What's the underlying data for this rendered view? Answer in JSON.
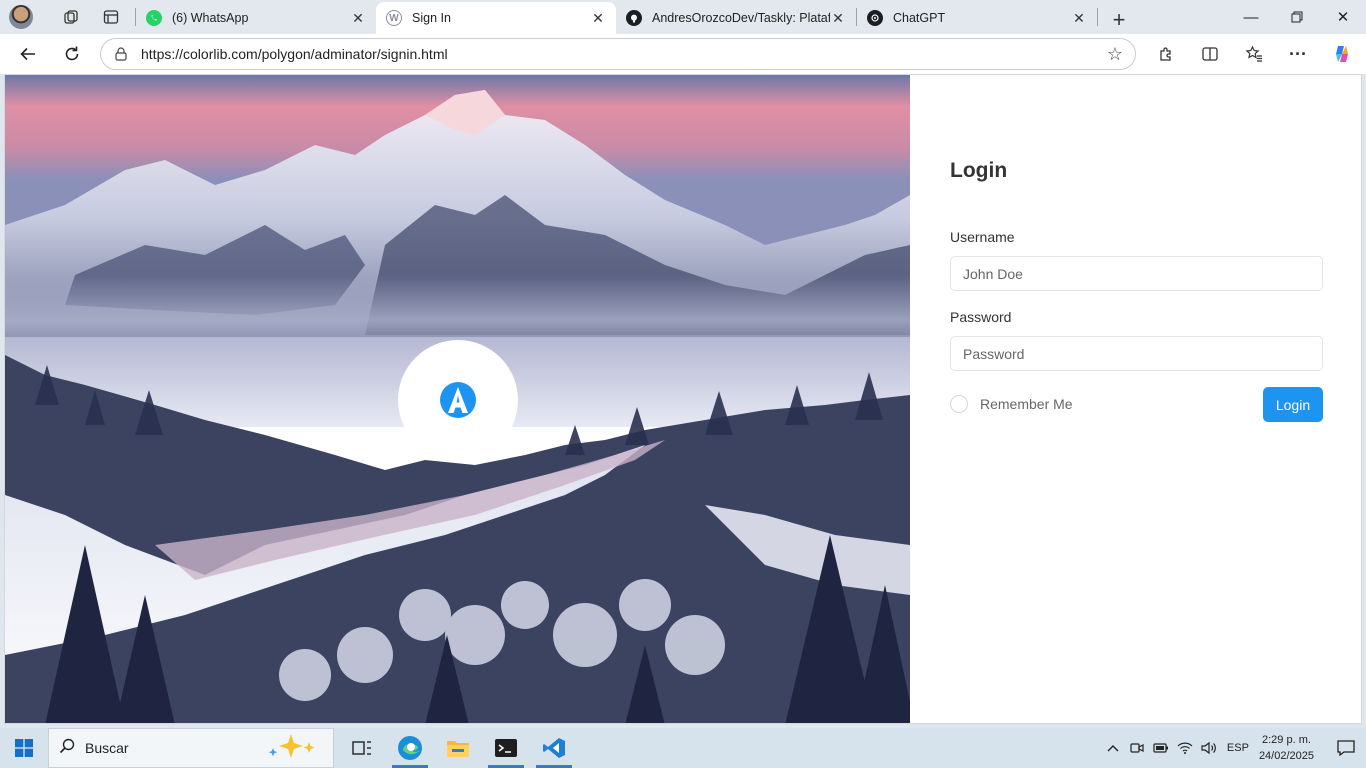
{
  "browser": {
    "tabs": [
      {
        "title": "(6) WhatsApp",
        "favicon": "whatsapp-icon",
        "color": "#25d366",
        "active": false
      },
      {
        "title": "Sign In",
        "favicon": "wordpress-icon",
        "color": "#8a8f96",
        "active": true
      },
      {
        "title": "AndresOrozcoDev/Taskly: Platafor",
        "favicon": "github-icon",
        "color": "#1b1f23",
        "active": false
      },
      {
        "title": "ChatGPT",
        "favicon": "chatgpt-icon",
        "color": "#1b1f23",
        "active": false
      }
    ],
    "address": {
      "url": "https://colorlib.com/polygon/adminator/signin.html"
    }
  },
  "page": {
    "logo_letter": "A",
    "brand_color": "#1d94f0",
    "form": {
      "title": "Login",
      "username_label": "Username",
      "username_placeholder": "John Doe",
      "password_label": "Password",
      "password_placeholder": "Password",
      "remember_label": "Remember Me",
      "submit_label": "Login"
    }
  },
  "taskbar": {
    "search_placeholder": "Buscar",
    "language": "ESP",
    "time": "2:29 p. m.",
    "date": "24/02/2025"
  }
}
